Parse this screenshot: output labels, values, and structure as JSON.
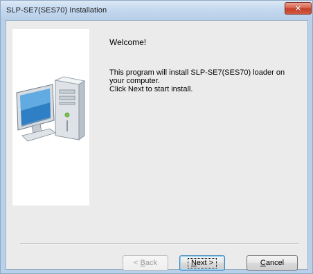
{
  "window": {
    "title": "SLP-SE7(SES70) Installation",
    "close_symbol": "✕"
  },
  "content": {
    "welcome": "Welcome!",
    "lines": [
      "This program will install SLP-SE7(SES70) loader on",
      "your computer.",
      "Click Next to start install."
    ]
  },
  "buttons": {
    "back": {
      "prefix": "< ",
      "mnemonic": "B",
      "rest": "ack",
      "enabled": false
    },
    "next": {
      "prefix": "",
      "mnemonic": "N",
      "rest": "ext >",
      "enabled": true,
      "default": true
    },
    "cancel": {
      "prefix": "",
      "mnemonic": "C",
      "rest": "ancel",
      "enabled": true
    }
  },
  "icons": {
    "close": "close-icon",
    "illustration": "computer-icon"
  },
  "colors": {
    "title_bar": "#c5d9ef",
    "close_button": "#c23f28",
    "dialog_background": "#ebebeb",
    "illustration_panel": "#ffffff",
    "default_button_border": "#3c7fb1"
  }
}
